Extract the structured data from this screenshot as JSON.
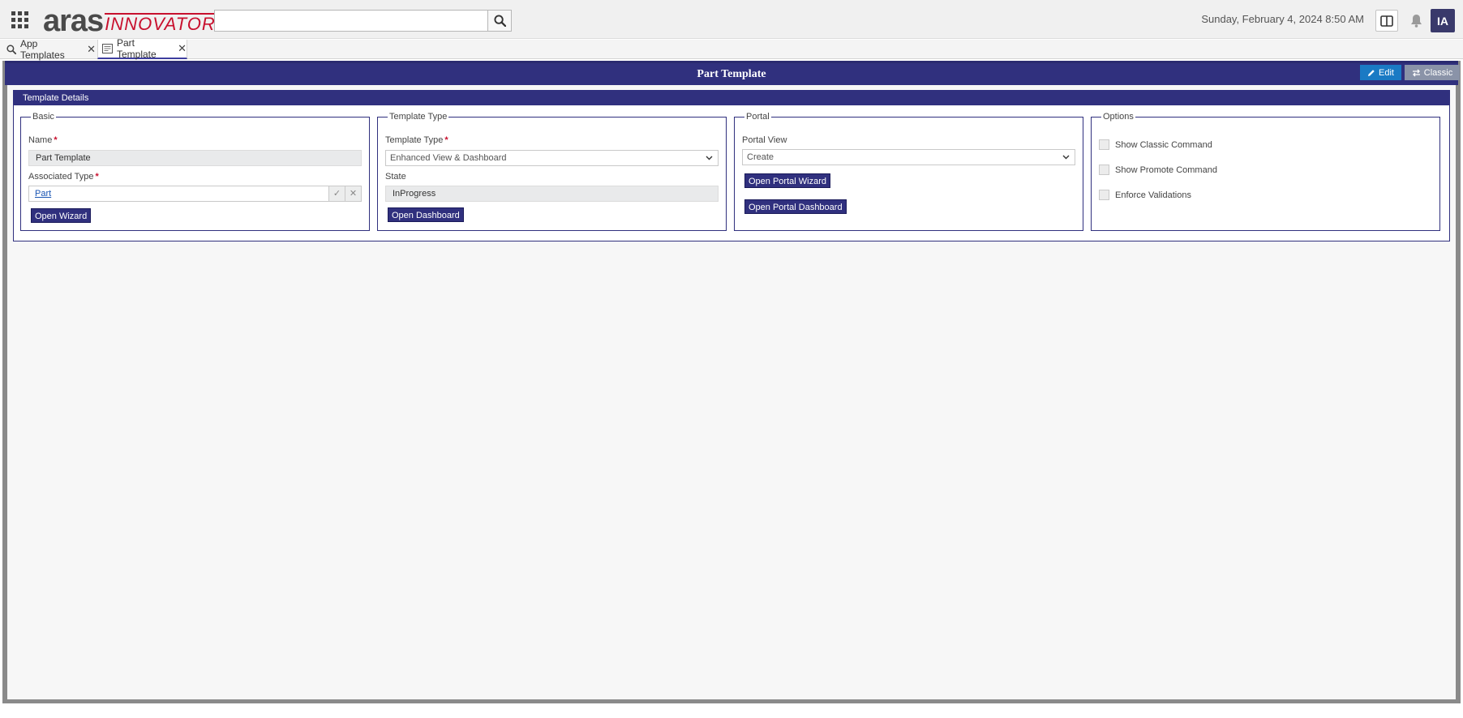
{
  "header": {
    "logo_primary": "aras",
    "logo_secondary": "INNOVATOR",
    "search_value": "",
    "datetime": "Sunday, February 4, 2024 8:50 AM",
    "avatar_initials": "IA",
    "icons": {
      "apps": "grid-icon",
      "search": "search-icon",
      "split": "split-view-icon",
      "notifications": "bell-icon"
    }
  },
  "tabs": [
    {
      "label": "App Templates",
      "icon": "search-icon",
      "close": "✕",
      "active": false
    },
    {
      "label": "Part Template",
      "icon": "form-icon",
      "close": "✕",
      "active": true
    }
  ],
  "page": {
    "title": "Part Template",
    "edit_label": "Edit",
    "classic_label": "Classic"
  },
  "details": {
    "heading": "Template Details",
    "basic": {
      "legend": "Basic",
      "name_label": "Name",
      "name_value": "Part Template",
      "assoc_label": "Associated Type",
      "assoc_value": "Part",
      "wizard_button": "Open Wizard"
    },
    "template_type": {
      "legend": "Template Type",
      "type_label": "Template Type",
      "type_value": "Enhanced View & Dashboard",
      "state_label": "State",
      "state_value": "InProgress",
      "dashboard_button": "Open Dashboard"
    },
    "portal": {
      "legend": "Portal",
      "view_label": "Portal View",
      "view_value": "Create",
      "wizard_button": "Open Portal Wizard",
      "dashboard_button": "Open Portal Dashboard"
    },
    "options": {
      "legend": "Options",
      "items": [
        {
          "label": "Show Classic Command",
          "checked": false
        },
        {
          "label": "Show Promote Command",
          "checked": false
        },
        {
          "label": "Enforce Validations",
          "checked": false
        }
      ]
    }
  },
  "colors": {
    "brand_navy": "#30307e",
    "logo_red": "#c8102e",
    "edit_blue": "#1a7ac4",
    "classic_gray": "#8a93a8"
  }
}
